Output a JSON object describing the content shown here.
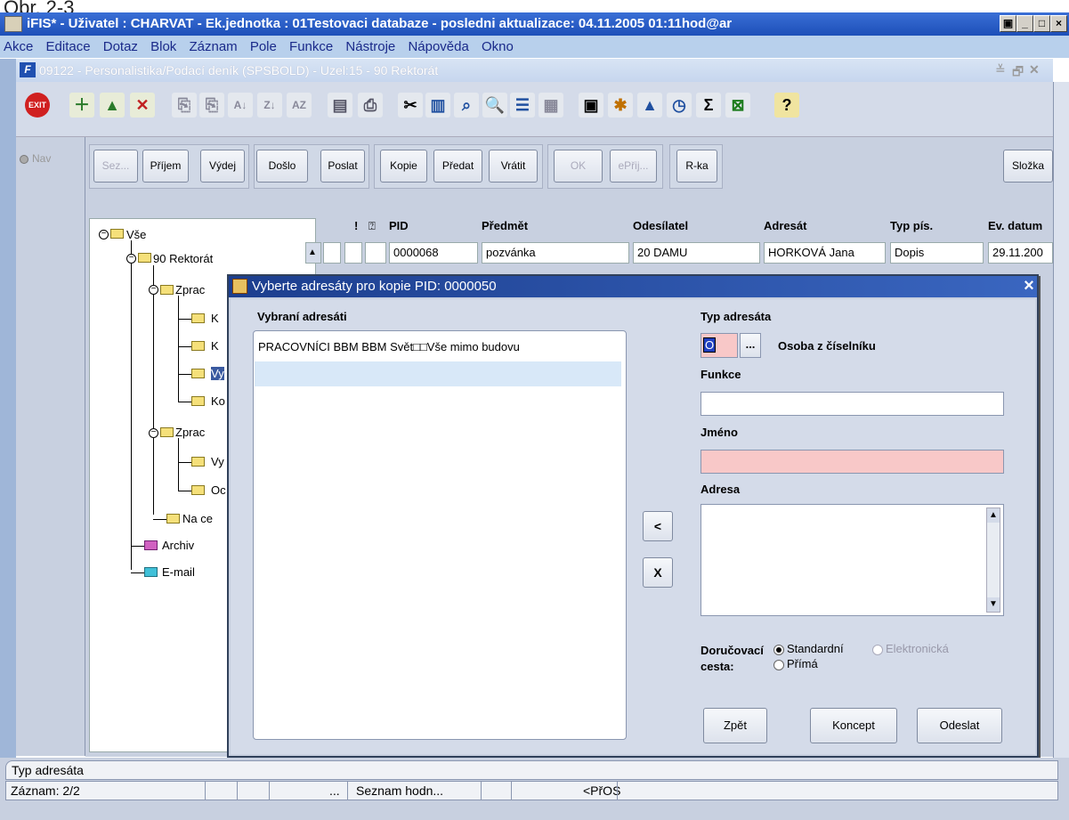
{
  "doc_caption": "Obr. 2-3",
  "window": {
    "title": "iFIS* - Uživatel : CHARVAT - Ek.jednotka : 01Testovaci databaze - posledni aktualizace: 04.11.2005 01:11hod@ar",
    "min": "_",
    "max": "□",
    "close": "×"
  },
  "menu": [
    "Akce",
    "Editace",
    "Dotaz",
    "Blok",
    "Záznam",
    "Pole",
    "Funkce",
    "Nástroje",
    "Nápověda",
    "Okno"
  ],
  "subwindow": {
    "title": "09122 - Personalistika/Podací deník (SPSBOLD) - Uzel:15 - 90 Rektorát",
    "ctl_min": "≚",
    "ctl_max": "🗗",
    "ctl_close": "✕"
  },
  "toolbar_icons": [
    "exit-icon",
    "new-record-icon",
    "insert-record-icon",
    "delete-record-icon",
    "copy-field-icon",
    "copy-record-icon",
    "sort-asc-icon",
    "sort-desc-icon",
    "sort-multi-icon",
    "print-icon",
    "print-preview-icon",
    "cut-icon",
    "clipboard-icon",
    "find-icon",
    "search-icon",
    "list-icon",
    "columns-icon",
    "export-icon",
    "puzzle-icon",
    "triangle-icon",
    "clock-icon",
    "sum-icon",
    "excel-icon",
    "help-icon"
  ],
  "nav": {
    "label": "Nav"
  },
  "buttons": {
    "sez": "Sez...",
    "prijem": "Příjem",
    "vydej": "Výdej",
    "doslo": "Došlo",
    "poslat": "Poslat",
    "kopie": "Kopie",
    "predat": "Předat",
    "vratit": "Vrátit",
    "ok": "OK",
    "eprij": "ePřij...",
    "rka": "R-ka",
    "slozka": "Složka"
  },
  "tree": {
    "root": "Vše",
    "rektorat": "90 Rektorát",
    "zprac1": "Zprac",
    "k1": "K",
    "k2": "K",
    "vy1": "Vy",
    "ko": "Ko",
    "zprac2": "Zprac",
    "vy2": "Vy",
    "oc": "Oc",
    "nace": "Na ce",
    "archiv": "Archiv",
    "email": "E-mail"
  },
  "grid": {
    "headers": {
      "excl": "!",
      "pid": "PID",
      "predmet": "Předmět",
      "odesilatel": "Odesílatel",
      "adresat": "Adresát",
      "typ": "Typ pís.",
      "ev": "Ev. datum"
    },
    "row": {
      "pid": "0000068",
      "predmet": "pozvánka",
      "odesilatel": "20 DAMU",
      "adresat": "HORKOVÁ Jana",
      "typ": "Dopis",
      "ev": "29.11.200"
    }
  },
  "dialog": {
    "title": "Vyberte adresáty pro kopie PID: 0000050",
    "selected_label": "Vybraní adresáti",
    "recipients": [
      "PRACOVNÍCI BBM BBM   Svět□□Vše mimo budovu",
      ""
    ],
    "typ_label": "Typ adresáta",
    "typ_value": "O",
    "typ_lov": "...",
    "typ_desc": "Osoba z číselníku",
    "funkce_label": "Funkce",
    "funkce_value": "",
    "jmeno_label": "Jméno",
    "jmeno_value": "",
    "adresa_label": "Adresa",
    "adresa_value": "",
    "btn_left": "<",
    "btn_x": "X",
    "cesta_label": "Doručovací cesta:",
    "cesta_options": {
      "standard": "Standardní",
      "elektronicka": "Elektronická",
      "prima": "Přímá"
    },
    "cesta_selected": "Standardní",
    "btn_zpet": "Zpět",
    "btn_koncept": "Koncept",
    "btn_odeslat": "Odeslat",
    "close": "×"
  },
  "status": {
    "line1": "Typ adresáta",
    "zaznam": "Záznam: 2/2",
    "dots": "...",
    "seznam": "Seznam hodn...",
    "pros": "<PřOS"
  },
  "colors": {
    "titlebar": "#2a5cc8",
    "menu": "#b8d0ec",
    "required": "#f8c8c8",
    "panel": "#c8d0e0"
  }
}
